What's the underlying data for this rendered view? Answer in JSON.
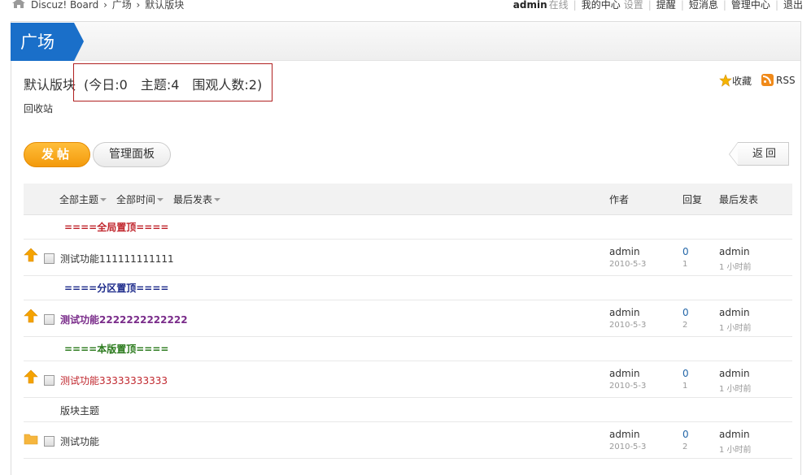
{
  "breadcrumb": {
    "items": [
      "Discuz! Board",
      "›",
      "广场",
      "›",
      "默认版块"
    ]
  },
  "usernav": {
    "username": "admin",
    "status": "在线",
    "my_center": "我的中心",
    "settings": "设置",
    "remind": "提醒",
    "messages": "短消息",
    "admin_center": "管理中心",
    "logout": "退出"
  },
  "tab": {
    "label": "广场"
  },
  "forum": {
    "name": "默认版块",
    "stats_open": "(今日:0",
    "stats_topics": "主题:4",
    "stats_watchers": "围观人数:2)",
    "recycle": "回收站",
    "favorite": "收藏",
    "rss": "RSS"
  },
  "actions": {
    "post": "发帖",
    "manage": "管理面板",
    "back": "返回"
  },
  "table": {
    "filters": [
      "全部主题",
      "全部时间",
      "最后发表"
    ],
    "col_author": "作者",
    "col_replies": "回复",
    "col_last": "最后发表"
  },
  "separators": {
    "global": "====全局置顶====",
    "zone": "====分区置顶====",
    "board": "====本版置顶===="
  },
  "section_label": "版块主题",
  "threads": [
    {
      "title": "测试功能111111111111",
      "author": "admin",
      "date": "2010-5-3",
      "replies": "0",
      "views": "1",
      "last_user": "admin",
      "last_time": "1 小时前",
      "title_color": "#333333"
    },
    {
      "title": "测试功能2222222222222",
      "author": "admin",
      "date": "2010-5-3",
      "replies": "0",
      "views": "2",
      "last_user": "admin",
      "last_time": "1 小时前",
      "title_color": "#7a2c8a"
    },
    {
      "title": "测试功能33333333333",
      "author": "admin",
      "date": "2010-5-3",
      "replies": "0",
      "views": "1",
      "last_user": "admin",
      "last_time": "1 小时前",
      "title_color": "#c0262d"
    },
    {
      "title": "测试功能",
      "author": "admin",
      "date": "2010-5-3",
      "replies": "0",
      "views": "2",
      "last_user": "admin",
      "last_time": "1 小时前",
      "title_color": "#333333"
    }
  ],
  "colors": {
    "brand_blue": "#1a6fc9",
    "post_orange": "#f39a0c",
    "sep_global": "#c0262d",
    "sep_zone": "#1c2a8a",
    "sep_board": "#2a7a1c"
  }
}
